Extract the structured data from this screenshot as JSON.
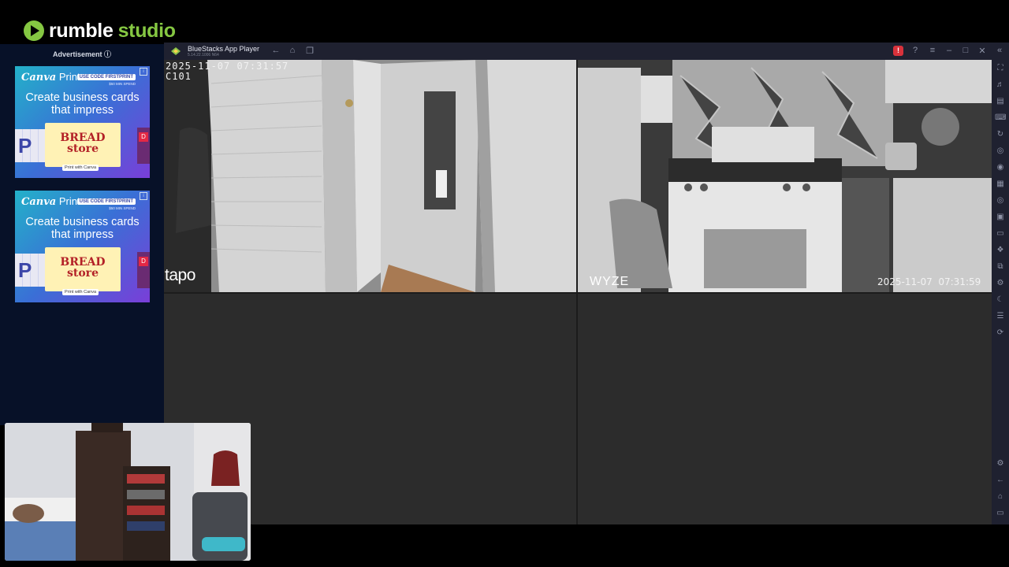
{
  "header": {
    "logo_word1": "rumble",
    "logo_word2": "studio"
  },
  "sidebar": {
    "ad_label": "Advertisement ⓘ",
    "ads": [
      {
        "brand": "Canva",
        "brand_suffix": " Print",
        "code": "USE CODE FIRSTPRINT",
        "spend": "$50 MIN SPEND",
        "headline": "Create business cards that impress",
        "card_text": "BREAD store",
        "cta": "Print with Canva"
      },
      {
        "brand": "Canva",
        "brand_suffix": " Print",
        "code": "USE CODE FIRSTPRINT",
        "spend": "$50 MIN SPEND",
        "headline": "Create business cards that impress",
        "card_text": "BREAD store",
        "cta": "Print with Canva"
      }
    ]
  },
  "bluestacks": {
    "title": "BlueStacks App Player",
    "version": "5.14.22.1006 N64",
    "alert_badge": "!"
  },
  "cameras": [
    {
      "timestamp": "2025-11-07 07:31:57",
      "channel": "C101",
      "brand": "tapo"
    },
    {
      "timestamp": "2025-11-07  07:31:59",
      "brand": "WYZE"
    }
  ],
  "colors": {
    "accent": "#85c742",
    "sidebar_bg": "#071128",
    "bluestacks_bar": "#1f2130",
    "grid_bg": "#2c2c2c"
  }
}
